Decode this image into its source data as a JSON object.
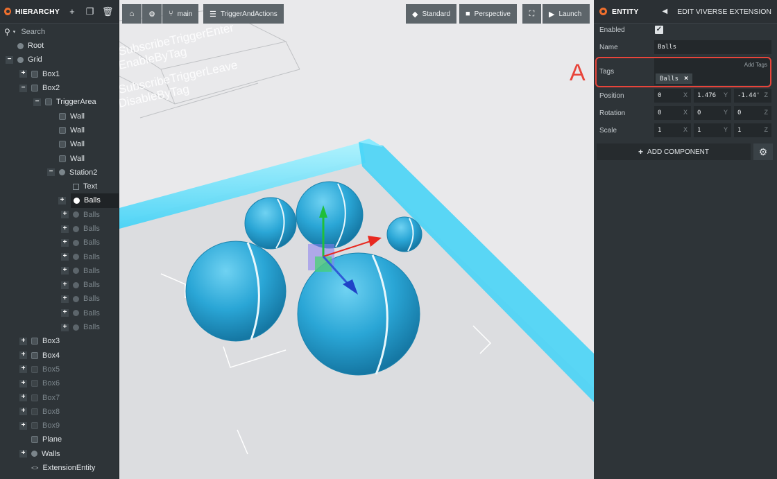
{
  "hierarchy": {
    "title": "HIERARCHY",
    "search_placeholder": "Search",
    "items": [
      {
        "label": "Root",
        "indent": 0,
        "toggle": "",
        "icon": "dot",
        "dim": false,
        "selected": false
      },
      {
        "label": "Grid",
        "indent": 0,
        "toggle": "−",
        "icon": "dot",
        "dim": false,
        "selected": false
      },
      {
        "label": "Box1",
        "indent": 1,
        "toggle": "+",
        "icon": "cube",
        "dim": false,
        "selected": false
      },
      {
        "label": "Box2",
        "indent": 1,
        "toggle": "−",
        "icon": "cube",
        "dim": false,
        "selected": false
      },
      {
        "label": "TriggerArea",
        "indent": 2,
        "toggle": "−",
        "icon": "cube",
        "dim": false,
        "selected": false
      },
      {
        "label": "Wall",
        "indent": 3,
        "toggle": "",
        "icon": "cube",
        "dim": false,
        "selected": false
      },
      {
        "label": "Wall",
        "indent": 3,
        "toggle": "",
        "icon": "cube",
        "dim": false,
        "selected": false
      },
      {
        "label": "Wall",
        "indent": 3,
        "toggle": "",
        "icon": "cube",
        "dim": false,
        "selected": false
      },
      {
        "label": "Wall",
        "indent": 3,
        "toggle": "",
        "icon": "cube",
        "dim": false,
        "selected": false
      },
      {
        "label": "Station2",
        "indent": 3,
        "toggle": "−",
        "icon": "dot",
        "dim": false,
        "selected": false
      },
      {
        "label": "Text",
        "indent": 4,
        "toggle": "",
        "icon": "square",
        "dim": false,
        "selected": false
      },
      {
        "label": "Balls",
        "indent": 4,
        "toggle": "+",
        "icon": "dot-white",
        "dim": false,
        "selected": true
      },
      {
        "label": "Balls",
        "indent": 4,
        "toggle": "+",
        "icon": "dot-dim",
        "dim": true,
        "selected": false
      },
      {
        "label": "Balls",
        "indent": 4,
        "toggle": "+",
        "icon": "dot-dim",
        "dim": true,
        "selected": false
      },
      {
        "label": "Balls",
        "indent": 4,
        "toggle": "+",
        "icon": "dot-dim",
        "dim": true,
        "selected": false
      },
      {
        "label": "Balls",
        "indent": 4,
        "toggle": "+",
        "icon": "dot-dim",
        "dim": true,
        "selected": false
      },
      {
        "label": "Balls",
        "indent": 4,
        "toggle": "+",
        "icon": "dot-dim",
        "dim": true,
        "selected": false
      },
      {
        "label": "Balls",
        "indent": 4,
        "toggle": "+",
        "icon": "dot-dim",
        "dim": true,
        "selected": false
      },
      {
        "label": "Balls",
        "indent": 4,
        "toggle": "+",
        "icon": "dot-dim",
        "dim": true,
        "selected": false
      },
      {
        "label": "Balls",
        "indent": 4,
        "toggle": "+",
        "icon": "dot-dim",
        "dim": true,
        "selected": false
      },
      {
        "label": "Balls",
        "indent": 4,
        "toggle": "+",
        "icon": "dot-dim",
        "dim": true,
        "selected": false
      },
      {
        "label": "Box3",
        "indent": 1,
        "toggle": "+",
        "icon": "cube",
        "dim": false,
        "selected": false
      },
      {
        "label": "Box4",
        "indent": 1,
        "toggle": "+",
        "icon": "cube",
        "dim": false,
        "selected": false
      },
      {
        "label": "Box5",
        "indent": 1,
        "toggle": "+",
        "icon": "cube",
        "dim": true,
        "selected": false
      },
      {
        "label": "Box6",
        "indent": 1,
        "toggle": "+",
        "icon": "cube",
        "dim": true,
        "selected": false
      },
      {
        "label": "Box7",
        "indent": 1,
        "toggle": "+",
        "icon": "cube",
        "dim": true,
        "selected": false
      },
      {
        "label": "Box8",
        "indent": 1,
        "toggle": "+",
        "icon": "cube",
        "dim": true,
        "selected": false
      },
      {
        "label": "Box9",
        "indent": 1,
        "toggle": "+",
        "icon": "cube",
        "dim": true,
        "selected": false
      },
      {
        "label": "Plane",
        "indent": 1,
        "toggle": "",
        "icon": "cube",
        "dim": false,
        "selected": false
      },
      {
        "label": "Walls",
        "indent": 1,
        "toggle": "+",
        "icon": "dot",
        "dim": false,
        "selected": false
      },
      {
        "label": "ExtensionEntity",
        "indent": 1,
        "toggle": "",
        "icon": "code",
        "dim": false,
        "selected": false
      }
    ]
  },
  "viewport": {
    "toolbar_left": {
      "home_icon": "home-icon",
      "settings_icon": "gear-icon",
      "branch_label": "main",
      "scene_label": "TriggerAndActions"
    },
    "toolbar_right": {
      "standard_label": "Standard",
      "perspective_label": "Perspective",
      "launch_label": "Launch"
    },
    "scene_texts": [
      "SubscribeTriggerEnter",
      "EnableByTag",
      "SubscribeTriggerLeave",
      "DisableByTag"
    ]
  },
  "entity": {
    "title": "ENTITY",
    "edit_label": "EDIT VIVERSE EXTENSION",
    "enabled_label": "Enabled",
    "enabled": true,
    "name_label": "Name",
    "name_value": "Balls",
    "tags_label": "Tags",
    "add_tags_placeholder": "Add Tags",
    "tags": [
      "Balls"
    ],
    "position_label": "Position",
    "position": {
      "x": "0",
      "y": "1.476",
      "z": "-1.44'"
    },
    "rotation_label": "Rotation",
    "rotation": {
      "x": "0",
      "y": "0",
      "z": "0"
    },
    "scale_label": "Scale",
    "scale": {
      "x": "1",
      "y": "1",
      "z": "1"
    },
    "add_component_label": "ADD COMPONENT"
  },
  "annotation": {
    "letter": "A",
    "color": "#e8443a"
  },
  "colors": {
    "accent_orange": "#ef6f2d",
    "panel_bg": "#2e3438",
    "viewport_bg": "#e9e9eb",
    "ball_blue": "#2aa6d6",
    "wall_cyan": "#5ee6ff"
  }
}
